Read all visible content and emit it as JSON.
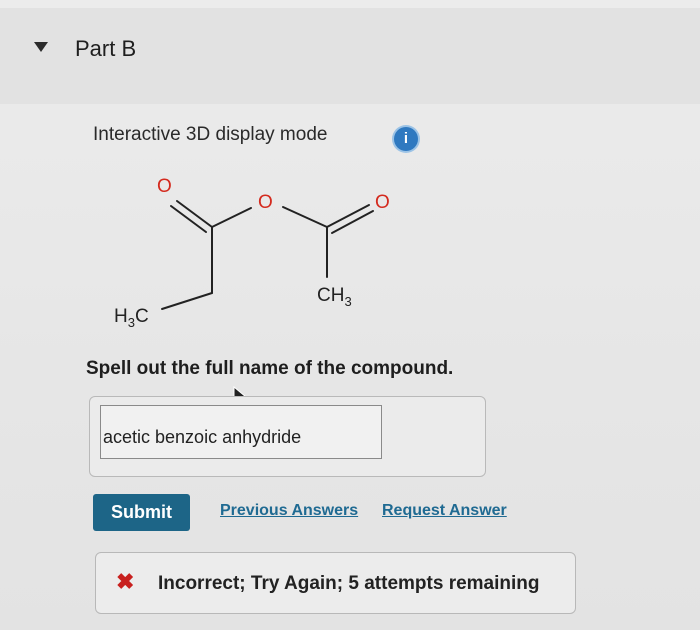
{
  "part": {
    "title": "Part B"
  },
  "display": {
    "mode_label": "Interactive 3D display mode",
    "info_icon": "info-icon",
    "info_glyph": "i"
  },
  "structure": {
    "carbonyl_o_left": "O",
    "ether_o": "O",
    "carbonyl_o_right": "O",
    "left_methyl_main": "H",
    "left_methyl_sub": "3",
    "left_methyl_tail": "C",
    "right_methyl_main": "CH",
    "right_methyl_sub": "3"
  },
  "question": {
    "prompt": "Spell out the full name of the compound."
  },
  "answer": {
    "value": "acetic benzoic anhydride"
  },
  "actions": {
    "submit_label": "Submit",
    "previous_answers_label": "Previous Answers",
    "request_answer_label": "Request Answer"
  },
  "feedback": {
    "icon": "x-icon",
    "mark": "✖",
    "message": "Incorrect; Try Again; 5 attempts remaining",
    "color": "#c8201e"
  },
  "colors": {
    "accent": "#1d6587",
    "link": "#1f6a92",
    "oxygen": "#d42a1e"
  }
}
